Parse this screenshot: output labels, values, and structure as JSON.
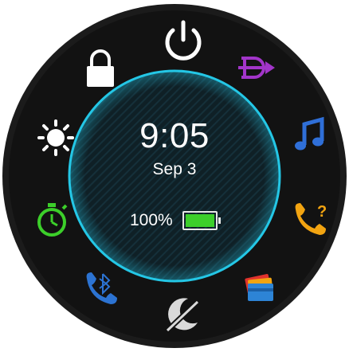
{
  "watch": {
    "time": "9:05",
    "date": "Sep 3",
    "battery": {
      "percent_label": "100%",
      "level": 1.0
    }
  },
  "controls": [
    {
      "name": "power-icon",
      "color": "#ffffff"
    },
    {
      "name": "find-phone-icon",
      "color": "#a235c9"
    },
    {
      "name": "music-icon",
      "color": "#2f6fd8"
    },
    {
      "name": "help-call-icon",
      "color": "#f2a411"
    },
    {
      "name": "wallet-icon",
      "color": "#2d84d6"
    },
    {
      "name": "do-not-disturb-icon",
      "color": "#d9d9d9"
    },
    {
      "name": "phone-bluetooth-icon",
      "color": "#2c73d2"
    },
    {
      "name": "stopwatch-icon",
      "color": "#3ccf2a"
    },
    {
      "name": "brightness-icon",
      "color": "#ffffff"
    },
    {
      "name": "lock-icon",
      "color": "#ffffff"
    }
  ],
  "colors": {
    "ring": "#24c7e6",
    "bezel": "#1a1a1a",
    "face": "#0d1b20"
  }
}
